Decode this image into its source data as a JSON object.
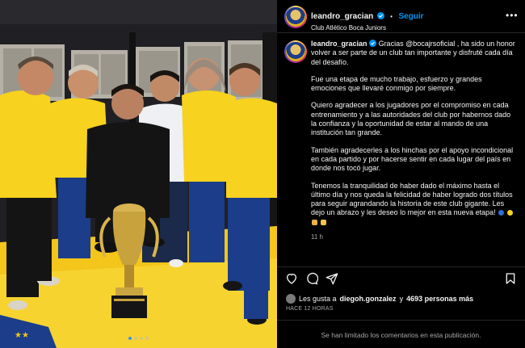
{
  "photo": {
    "alt": "",
    "carousel_count": 4,
    "carousel_active": 0
  },
  "header": {
    "username": "leandro_gracian",
    "follow_label": "Seguir",
    "follow_separator": "•",
    "location": "Club Atlético Boca Juniors",
    "more_label": "•••"
  },
  "caption": {
    "username": "leandro_gracian",
    "paragraphs": [
      "Gracias @bocajrsoficial , ha sido un honor volver a ser parte de un club tan importante y disfruté cada día del desafío.",
      "Fue una etapa de mucho trabajo, esfuerzo y grandes emociones que llevaré conmigo por siempre.",
      "Quiero agradecer a los jugadores por el compromiso en cada entrenamiento y a las autoridades del club por habernos dado la confianza y la oportunidad de estar al mando de una institución tan grande.",
      "También agradecerles a los hinchas por el apoyo incondicional en cada partido y por hacerse sentir en cada lugar del país en donde nos tocó jugar.",
      "Tenemos la tranquilidad de haber dado el máximo hasta el último día y nos queda la felicidad de haber logrado dos títulos para seguir agrandando la historia de este club gigante. Les dejo un abrazo y les deseo lo mejor en esta nueva etapa!"
    ],
    "emojis": [
      "blue-circle",
      "yellow-circle",
      "flexed-biceps",
      "raising-hands"
    ],
    "time": "11 h"
  },
  "likes": {
    "prefix": "Les gusta a",
    "user": "diegoh.gonzalez",
    "connector": "y",
    "others": "4693 personas más"
  },
  "posted": "HACE 12 HORAS",
  "comments_limited": "Se han limitado los comentarios en esta publicación.",
  "colors": {
    "accent": "#0095f6",
    "boca_yellow": "#f7d21e",
    "boca_blue": "#1b3d8a"
  }
}
